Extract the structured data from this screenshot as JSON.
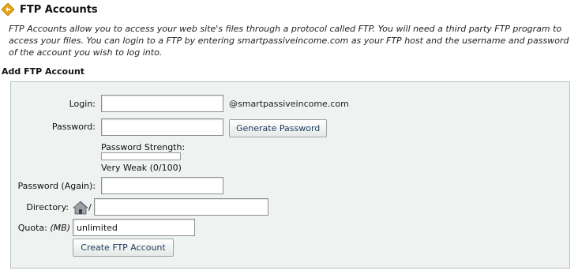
{
  "page": {
    "title": "FTP Accounts",
    "intro": "FTP Accounts allow you to access your web site's files through a protocol called FTP. You will need a third party FTP program to access your files. You can login to a FTP by entering smartpassiveincome.com as your FTP host and the username and password of the account you wish to log into."
  },
  "add_account": {
    "heading": "Add FTP Account",
    "login": {
      "label": "Login:",
      "value": "",
      "suffix": "@smartpassiveincome.com"
    },
    "password": {
      "label": "Password:",
      "value": ""
    },
    "generate_button": "Generate Password",
    "strength": {
      "label": "Password Strength:",
      "value_text": "Very Weak (0/100)",
      "score": 0
    },
    "password_again": {
      "label": "Password (Again):",
      "value": ""
    },
    "directory": {
      "label": "Directory:",
      "prefix": "/",
      "value": "",
      "icon": "home-icon"
    },
    "quota": {
      "label": "Quota:",
      "unit": "(MB)",
      "value": "unlimited"
    },
    "create_button": "Create FTP Account"
  },
  "colors": {
    "form_background": "#eef2f0",
    "button_text": "#1b3b5e",
    "title_icon": "#e8a317"
  }
}
